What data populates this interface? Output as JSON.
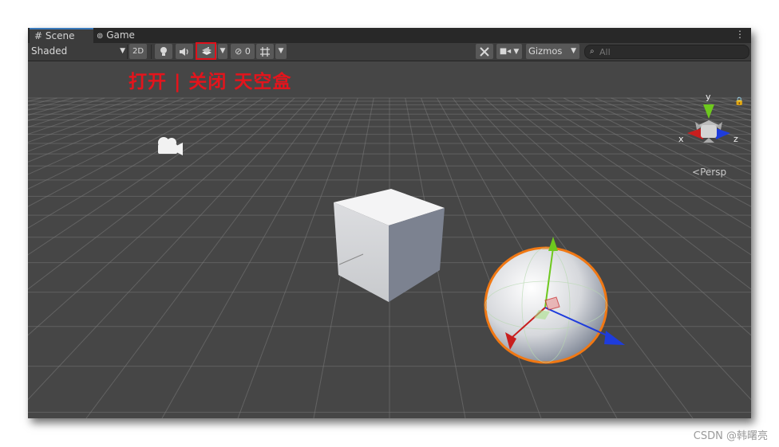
{
  "tabs": [
    {
      "label": "Scene",
      "icon": "grid-hash-icon",
      "active": true
    },
    {
      "label": "Game",
      "icon": "gamepad-icon",
      "active": false
    }
  ],
  "toolbar": {
    "shading_mode": "Shaded",
    "toggle_2d": "2D",
    "hidden_count": "0",
    "gizmos_label": "Gizmos",
    "search_placeholder": "All"
  },
  "annotation": {
    "text": "打开 | 关闭 天空盒",
    "color": "#e4141c"
  },
  "gizmo": {
    "axis_y": "y",
    "axis_x": "x",
    "axis_z": "z",
    "projection": "Persp"
  },
  "watermark": "CSDN @韩曙亮",
  "colors": {
    "viewport_bg": "#464646",
    "toolbar_bg": "#3c3c3c",
    "axis_x": "#c81e1e",
    "axis_y": "#6ec81e",
    "axis_z": "#1e3cdc",
    "selection_outline": "#f07814"
  }
}
